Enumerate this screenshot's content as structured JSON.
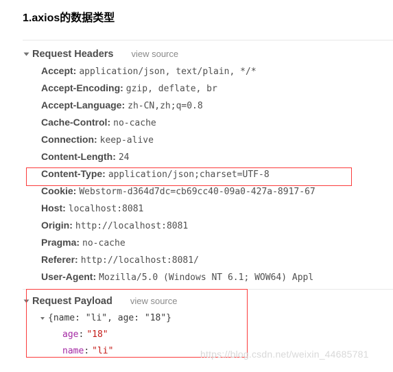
{
  "page": {
    "title": "1.axios的数据类型"
  },
  "devtools": {
    "request_headers": {
      "section_label": "Request Headers",
      "view_source_label": "view source",
      "expanded_icon": "triangle-down-icon",
      "headers": [
        {
          "name": "Accept:",
          "value": "application/json, text/plain, */*"
        },
        {
          "name": "Accept-Encoding:",
          "value": "gzip, deflate, br"
        },
        {
          "name": "Accept-Language:",
          "value": "zh-CN,zh;q=0.8"
        },
        {
          "name": "Cache-Control:",
          "value": "no-cache"
        },
        {
          "name": "Connection:",
          "value": "keep-alive"
        },
        {
          "name": "Content-Length:",
          "value": "24"
        },
        {
          "name": "Content-Type:",
          "value": "application/json;charset=UTF-8"
        },
        {
          "name": "Cookie:",
          "value": "Webstorm-d364d7dc=cb69cc40-09a0-427a-8917-67"
        },
        {
          "name": "Host:",
          "value": "localhost:8081"
        },
        {
          "name": "Origin:",
          "value": "http://localhost:8081"
        },
        {
          "name": "Pragma:",
          "value": "no-cache"
        },
        {
          "name": "Referer:",
          "value": "http://localhost:8081/"
        },
        {
          "name": "User-Agent:",
          "value": "Mozilla/5.0 (Windows NT 6.1; WOW64) Appl"
        }
      ]
    },
    "request_payload": {
      "section_label": "Request Payload",
      "view_source_label": "view source",
      "expanded_icon": "triangle-down-icon",
      "object_summary": "{name: \"li\", age: \"18\"}",
      "properties": [
        {
          "key": "age",
          "colon": ":",
          "value": "\"18\""
        },
        {
          "key": "name",
          "colon": ":",
          "value": "\"li\""
        }
      ]
    },
    "annotations": {
      "highlight_color": "#fb3b3b",
      "boxes": [
        {
          "name": "content-type-highlight"
        },
        {
          "name": "request-payload-highlight"
        }
      ]
    }
  },
  "watermark": {
    "text": "https://blog.csdn.net/weixin_44685781"
  }
}
